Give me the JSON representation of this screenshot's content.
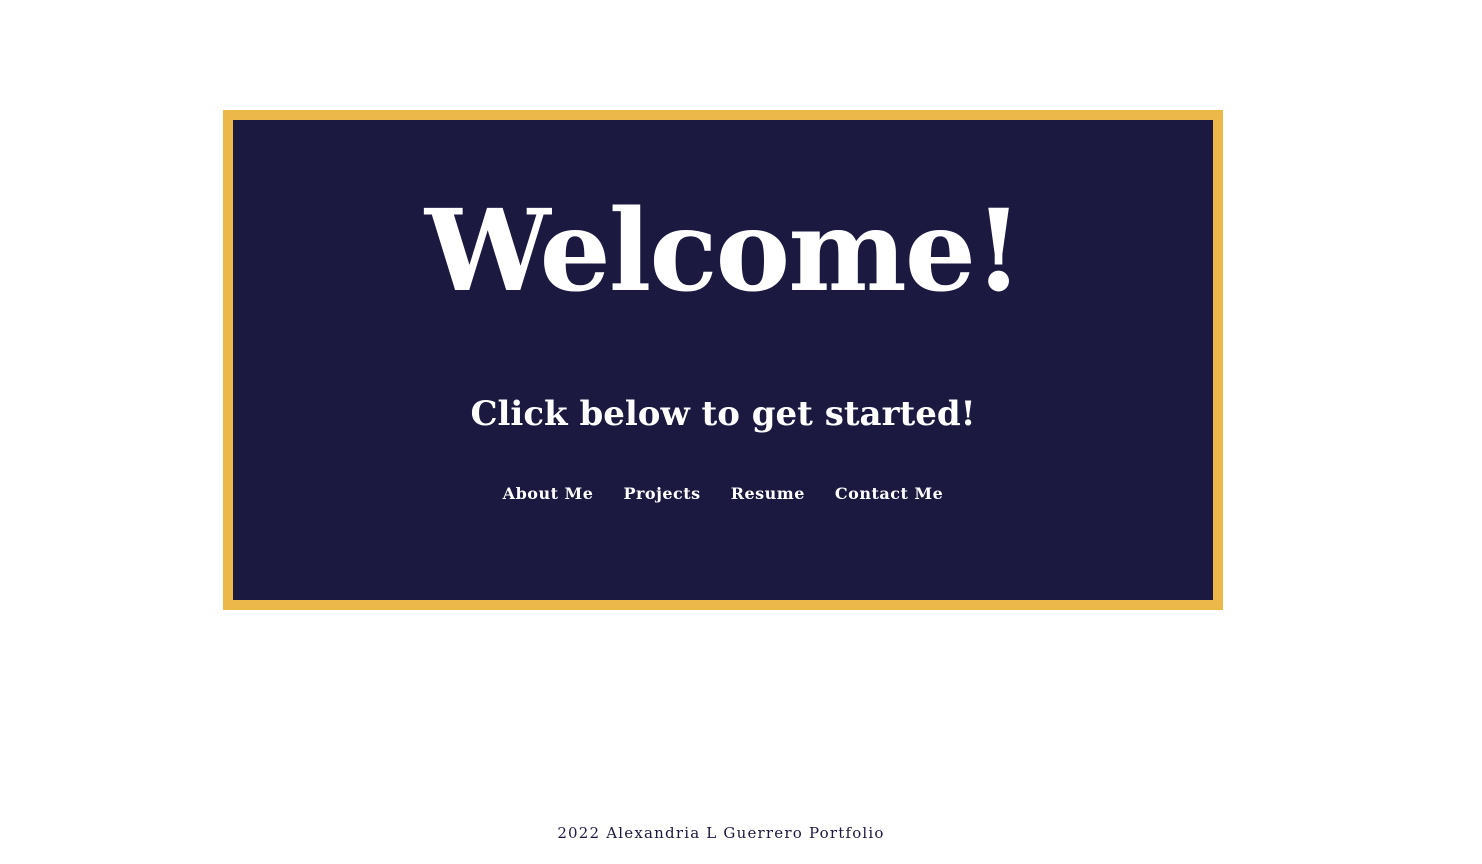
{
  "hero": {
    "title": "Welcome!",
    "subtitle": "Click below to get started!"
  },
  "nav": {
    "items": [
      {
        "label": "About Me"
      },
      {
        "label": "Projects"
      },
      {
        "label": "Resume"
      },
      {
        "label": "Contact Me"
      }
    ]
  },
  "footer": {
    "text": "2022 Alexandria L Guerrero Portfolio"
  },
  "colors": {
    "frame_border": "#ECB84A",
    "panel_background": "#1B1940",
    "text_light": "#FFFFFF",
    "page_background": "#FFFFFF"
  }
}
